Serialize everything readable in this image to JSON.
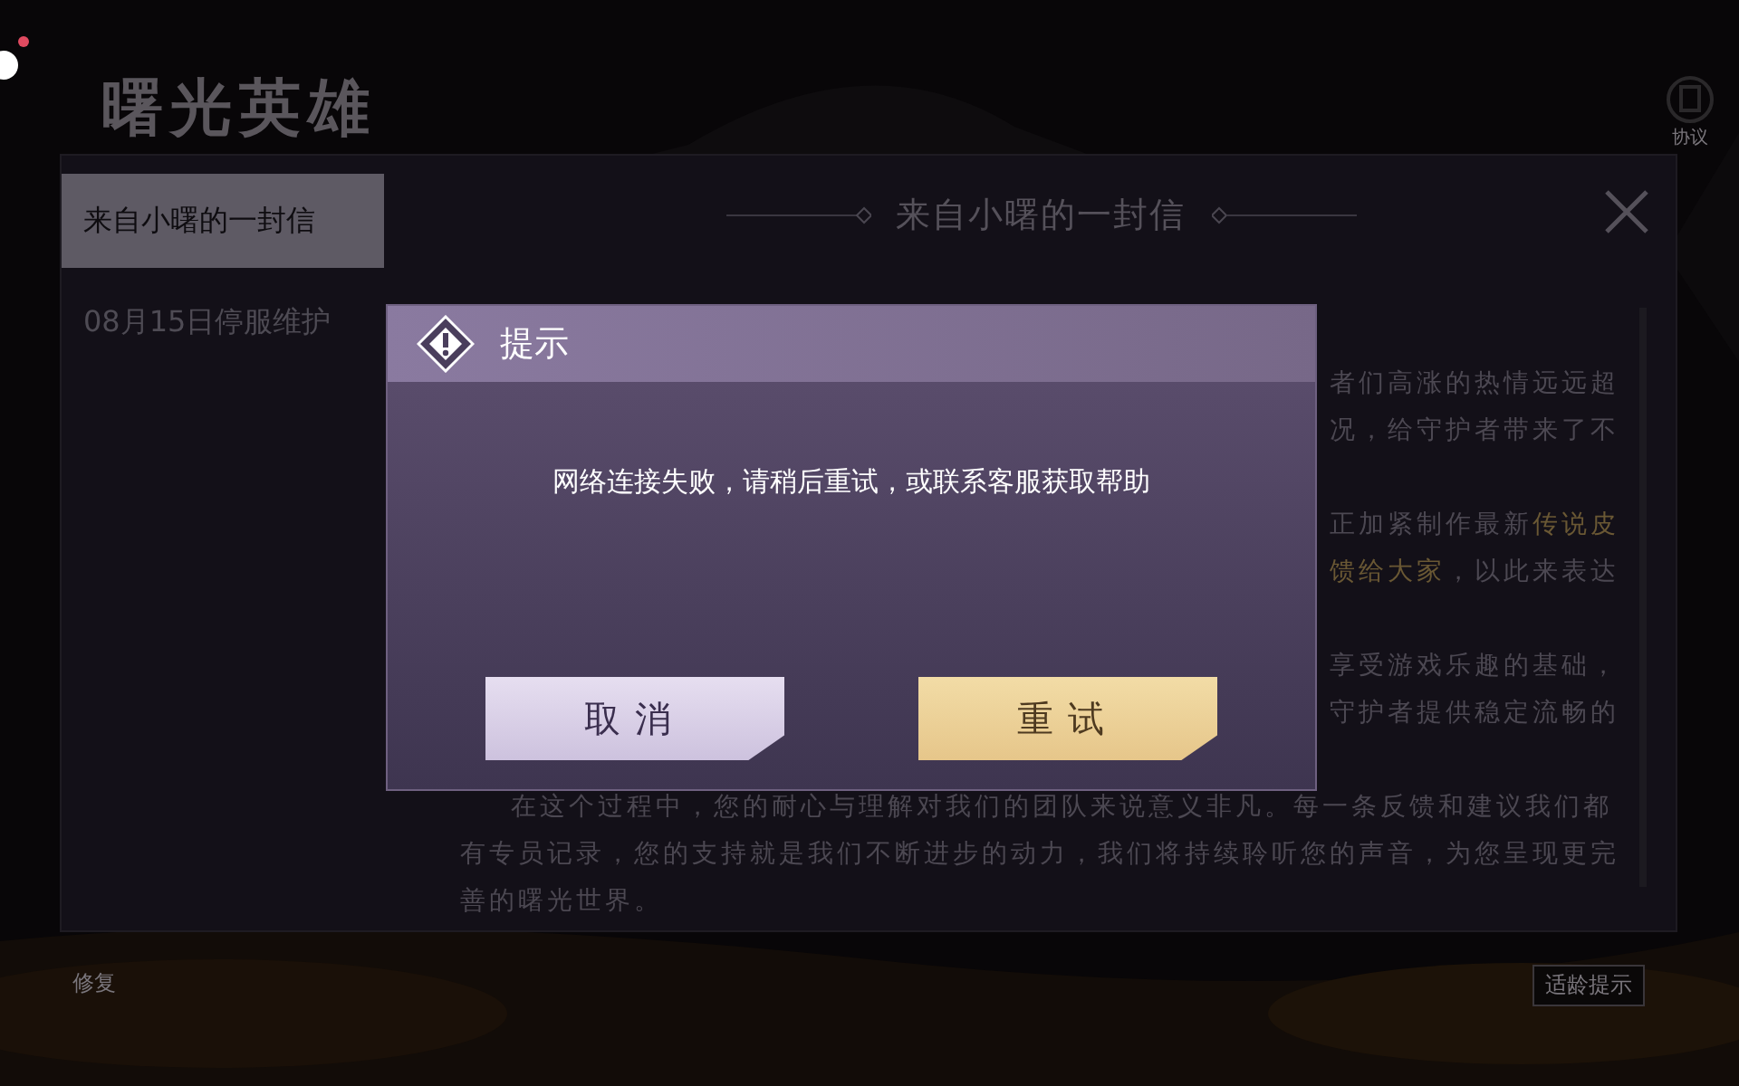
{
  "top_bar": {
    "logo": "曙光英雄",
    "agreement_label": "协议"
  },
  "letter_panel": {
    "tabs": [
      {
        "label": "来自小曙的一封信",
        "selected": true
      },
      {
        "label": "08月15日停服维护",
        "selected": false
      }
    ],
    "title": "来自小曙的一封信",
    "paragraphs": [
      {
        "kind": "partial",
        "lines": [
          [
            {
              "text": "者们高涨的热情远远超",
              "highlight": false
            }
          ],
          [
            {
              "text": "况，给守护者带来了不",
              "highlight": false
            }
          ]
        ]
      },
      {
        "kind": "partial",
        "lines": [
          [
            {
              "text": "正加紧制作最新",
              "highlight": false
            },
            {
              "text": "传说皮",
              "highlight": true
            }
          ],
          [
            {
              "text": "馈给大家",
              "highlight": true
            },
            {
              "text": "，以此来表达",
              "highlight": false
            }
          ]
        ]
      },
      {
        "kind": "partial",
        "lines": [
          [
            {
              "text": "享受游戏乐趣的基础，",
              "highlight": false
            }
          ],
          [
            {
              "text": "守护者提供稳定流畅的",
              "highlight": false
            }
          ]
        ]
      },
      {
        "kind": "full",
        "text": "在这个过程中，您的耐心与理解对我们的团队来说意义非凡。每一条反馈和建议我们都有专员记录，您的支持就是我们不断进步的动力，我们将持续聆听您的声音，为您呈现更完善的曙光世界。"
      }
    ]
  },
  "dialog": {
    "title": "提示",
    "message": "网络连接失败，请稍后重试，或联系客服获取帮助",
    "buttons": [
      {
        "label": "取消",
        "kind": "secondary"
      },
      {
        "label": "重试",
        "kind": "primary"
      }
    ]
  },
  "bottom_bar": {
    "repair_label": "修复",
    "age_hint": "适龄提示"
  }
}
